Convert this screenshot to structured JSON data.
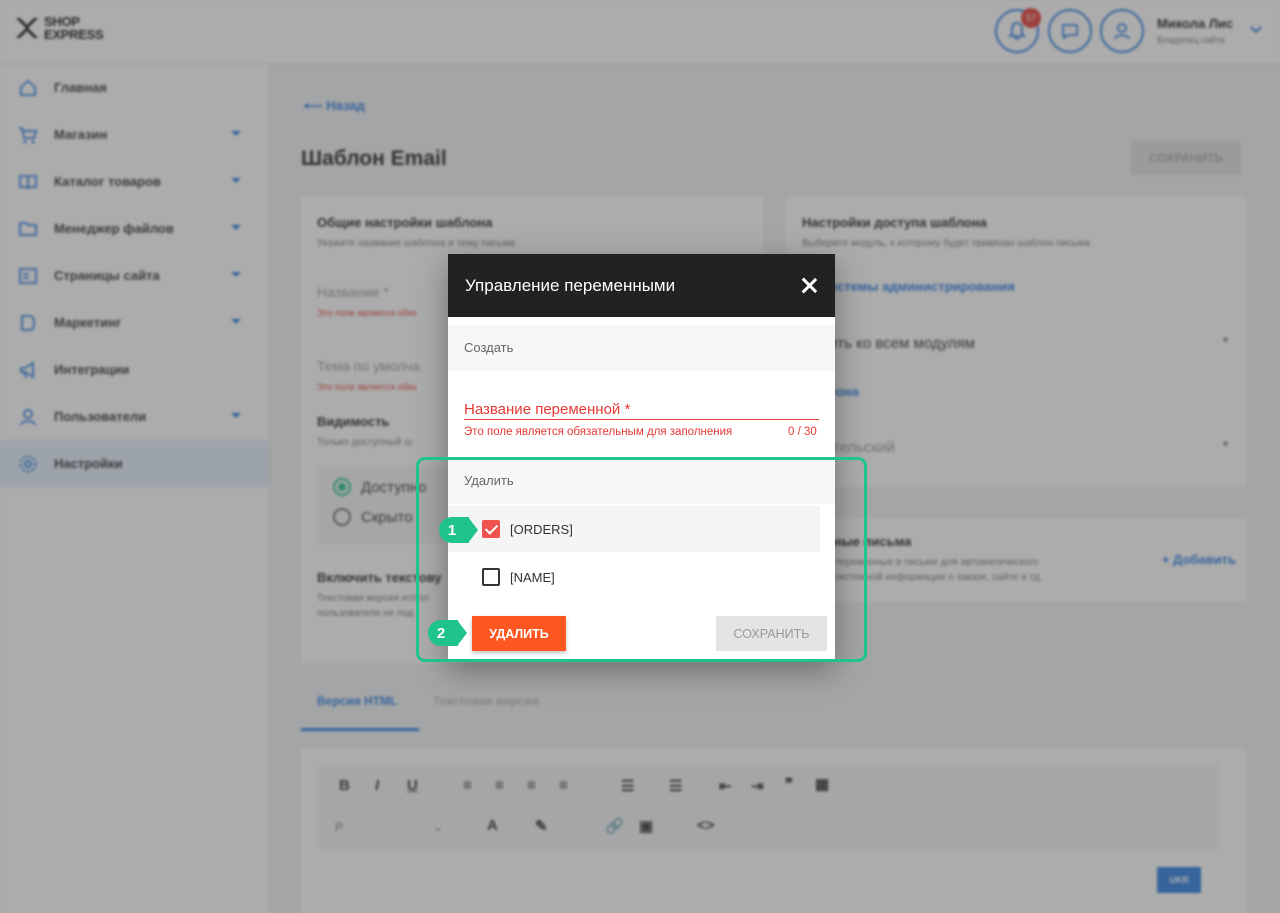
{
  "brand": {
    "line1": "SHOP",
    "line2": "EXPRESS"
  },
  "header": {
    "notif_count": "57",
    "user_name": "Микола Лис",
    "user_role": "Владелец сайта"
  },
  "sidebar": {
    "items": [
      {
        "label": "Главная",
        "icon": "home-icon"
      },
      {
        "label": "Магазин",
        "icon": "cart-icon"
      },
      {
        "label": "Каталог товаров",
        "icon": "book-icon"
      },
      {
        "label": "Менеджер файлов",
        "icon": "folder-icon"
      },
      {
        "label": "Страницы сайта",
        "icon": "pages-icon"
      },
      {
        "label": "Маркетинг",
        "icon": "marketing-icon"
      },
      {
        "label": "Интеграции",
        "icon": "megaphone-icon"
      },
      {
        "label": "Пользователи",
        "icon": "users-icon"
      },
      {
        "label": "Настройки",
        "icon": "gear-icon"
      }
    ]
  },
  "page": {
    "back": "Назад",
    "title": "Шаблон Email",
    "save": "СОХРАНИТЬ",
    "general": {
      "title": "Общие настройки шаблона",
      "subtitle": "Укажите название шаблона и тему письма",
      "name_label": "Название *",
      "name_error": "Это поле является обяз",
      "subject_label": "Тема по умолча",
      "subject_error": "Это поле является обяз",
      "visibility_title": "Видимость",
      "visibility_sub": "Только доступный ш",
      "option_available": "Доступно",
      "option_hidden": "Скрыто",
      "text_version_title": "Включить текстову",
      "text_version_sub1": "Текстовая версия испол",
      "text_version_sub2": "пользователя не под"
    },
    "access": {
      "title": "Настройки доступа шаблона",
      "subtitle": "Выберите модуль, к которому будет привязан шаблон письма",
      "module_link": "ль системы администрирования",
      "apply_label": "ь",
      "apply_value": "менить ко всем модулям",
      "type_link": "шаблона",
      "type_value": "зовательский"
    },
    "vars": {
      "title": "еменные письма",
      "line1": "ьзуйте переменные в письме для автоматического",
      "line2": "жения системной информации о заказе, сайте и тд.",
      "add": "Добавить"
    },
    "tabs": {
      "html": "Версия HTML",
      "text": "Текстовая версия"
    },
    "editor": {
      "format": "P",
      "lang": "UKR"
    }
  },
  "modal": {
    "title": "Управление переменными",
    "create_section": "Создать",
    "var_placeholder": "Название переменной *",
    "var_error": "Это поле является обязательным для заполнения",
    "var_counter": "0 / 30",
    "delete_section": "Удалить",
    "variables": [
      {
        "label": "[ORDERS]",
        "checked": true
      },
      {
        "label": "[NAME]",
        "checked": false
      }
    ],
    "delete_button": "УДАЛИТЬ",
    "save_button": "СОХРАНИТЬ"
  },
  "annotations": {
    "marker1": "1",
    "marker2": "2"
  },
  "colors": {
    "accent": "#2a7de1",
    "danger": "#e53935",
    "delete": "#ff5722",
    "highlight": "#1ec48a",
    "modal_header": "#222222"
  }
}
